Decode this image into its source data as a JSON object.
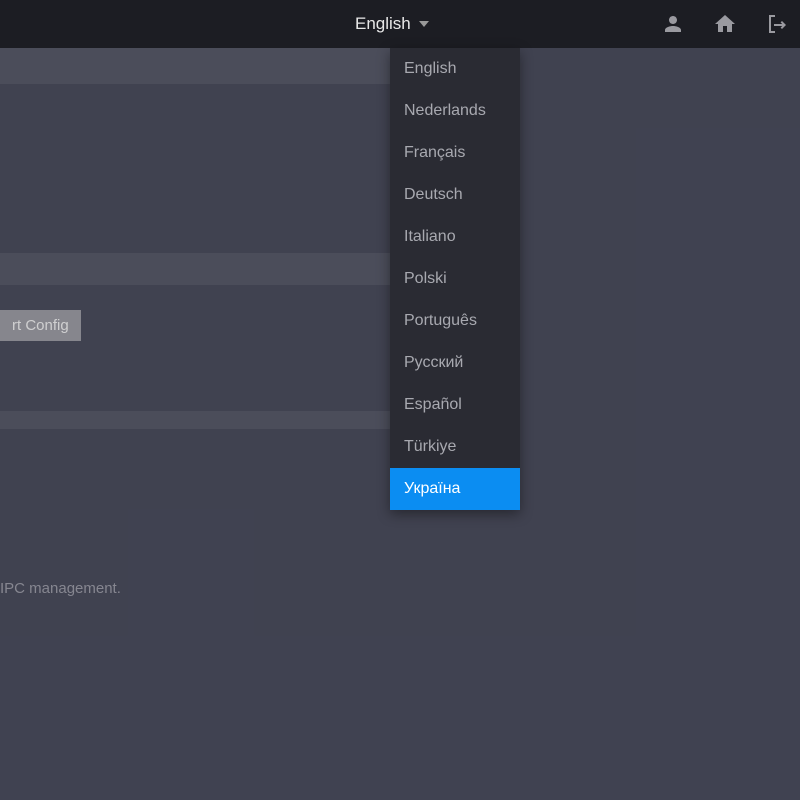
{
  "topbar": {
    "current_language": "English",
    "icons": {
      "user": "user-icon",
      "home": "home-icon",
      "logout": "logout-icon"
    }
  },
  "language_dropdown": {
    "items": [
      {
        "label": "English"
      },
      {
        "label": "Nederlands"
      },
      {
        "label": "Français"
      },
      {
        "label": "Deutsch"
      },
      {
        "label": "Italiano"
      },
      {
        "label": "Polski"
      },
      {
        "label": "Português"
      },
      {
        "label": "Русский"
      },
      {
        "label": "Español"
      },
      {
        "label": "Türkiye"
      },
      {
        "label": "Україна"
      }
    ],
    "selected_index": 10
  },
  "buttons": {
    "export_config": "rt Config"
  },
  "footer": {
    "text": "IPC management."
  }
}
